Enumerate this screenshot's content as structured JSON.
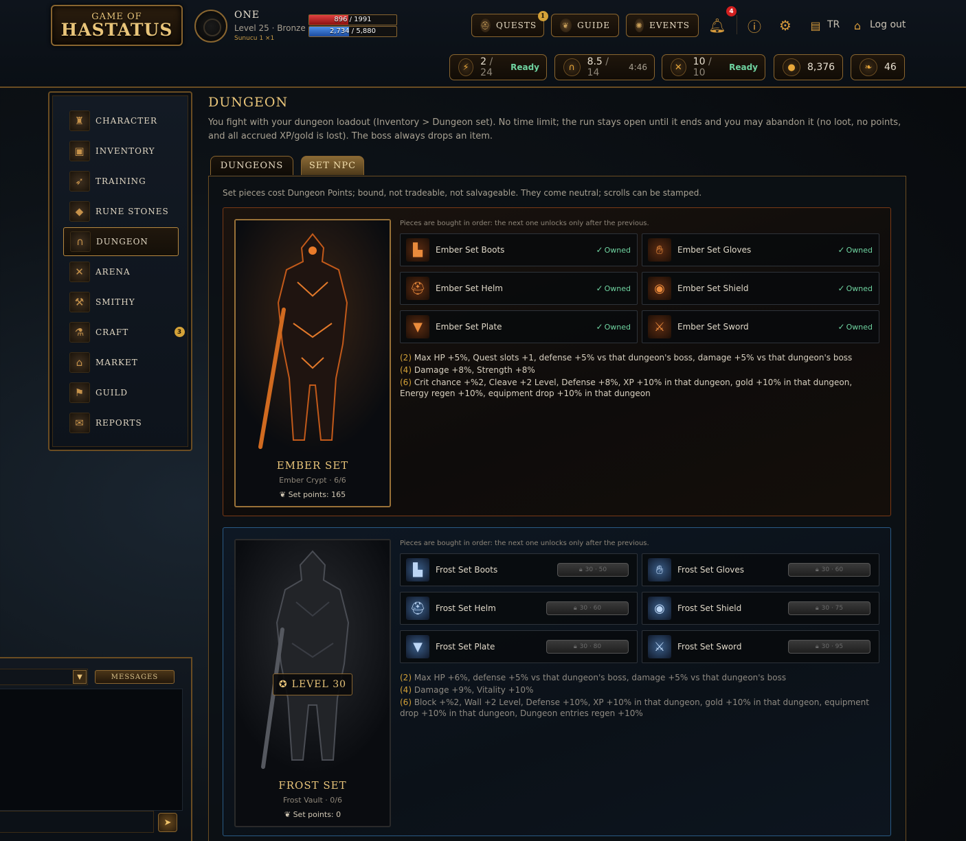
{
  "logo": {
    "line1": "GAME OF",
    "line2": "HASTATUS"
  },
  "player": {
    "name": "ONE",
    "level": "Level 25 · Bronze",
    "guild": "Sunucu 1 ×1",
    "hp": "896 / 1991",
    "hp_frac": 0.45,
    "xp": "2,734 / 5,880",
    "xp_frac": 0.46
  },
  "nav": {
    "quests": "QUESTS",
    "quests_badge": "1",
    "guide": "GUIDE",
    "events": "EVENTS",
    "alerts_badge": "4",
    "lang": "TR",
    "logout": "Log out"
  },
  "resources": {
    "energy": {
      "cur": "2",
      "max": "/ 24",
      "status": "Ready"
    },
    "dungeon": {
      "cur": "8.5",
      "max": "/ 14",
      "time": "4:46"
    },
    "arena": {
      "cur": "10",
      "max": "/ 10",
      "status": "Ready"
    },
    "gold": "8,376",
    "gems": "46"
  },
  "sidebar": {
    "items": [
      {
        "label": "CHARACTER"
      },
      {
        "label": "INVENTORY"
      },
      {
        "label": "TRAINING"
      },
      {
        "label": "RUNE STONES"
      },
      {
        "label": "DUNGEON"
      },
      {
        "label": "ARENA"
      },
      {
        "label": "SMITHY"
      },
      {
        "label": "CRAFT",
        "badge": "3"
      },
      {
        "label": "MARKET"
      },
      {
        "label": "GUILD"
      },
      {
        "label": "REPORTS"
      }
    ]
  },
  "chat": {
    "messages_label": "MESSAGES"
  },
  "page": {
    "title": "DUNGEON",
    "description": "You fight with your dungeon loadout (Inventory > Dungeon set). No time limit; the run stays open until it ends and you may abandon it (no loot, no points, and all accrued XP/gold is lost). The boss always drops an item.",
    "tabs": [
      "DUNGEONS",
      "SET NPC"
    ],
    "note": "Set pieces cost Dungeon Points; bound, not tradeable, not salvageable. They come neutral; scrolls can be stamped."
  },
  "sets": [
    {
      "name": "EMBER SET",
      "sub": "Ember Crypt · 6/6",
      "points": "Set points: 165",
      "order_note": "Pieces are bought in order: the next one unlocks only after the previous.",
      "pieces": [
        {
          "name": "Ember Set Boots",
          "status": "Owned"
        },
        {
          "name": "Ember Set Gloves",
          "status": "Owned"
        },
        {
          "name": "Ember Set Helm",
          "status": "Owned"
        },
        {
          "name": "Ember Set Shield",
          "status": "Owned"
        },
        {
          "name": "Ember Set Plate",
          "status": "Owned"
        },
        {
          "name": "Ember Set Sword",
          "status": "Owned"
        }
      ],
      "bonuses": [
        {
          "n": "(2)",
          "text": "Max HP +5%, Quest slots +1, defense +5% vs that dungeon's boss, damage +5% vs that dungeon's boss"
        },
        {
          "n": "(4)",
          "text": "Damage +8%, Strength +8%"
        },
        {
          "n": "(6)",
          "text": "Crit chance +%2, Cleave +2 Level, Defense +8%, XP +10% in that dungeon, gold +10% in that dungeon, Energy regen +10%, equipment drop +10% in that dungeon"
        }
      ]
    },
    {
      "name": "FROST SET",
      "sub": "Frost Vault · 0/6",
      "points": "Set points: 0",
      "level": "LEVEL 30",
      "order_note": "Pieces are bought in order: the next one unlocks only after the previous.",
      "pieces": [
        {
          "name": "Frost Set Boots",
          "cost": "30 · 50"
        },
        {
          "name": "Frost Set Gloves",
          "cost": "30 · 60"
        },
        {
          "name": "Frost Set Helm",
          "cost": "30 · 60"
        },
        {
          "name": "Frost Set Shield",
          "cost": "30 · 75"
        },
        {
          "name": "Frost Set Plate",
          "cost": "30 · 80"
        },
        {
          "name": "Frost Set Sword",
          "cost": "30 · 95"
        }
      ],
      "bonuses": [
        {
          "n": "(2)",
          "text": "Max HP +6%, defense +5% vs that dungeon's boss, damage +5% vs that dungeon's boss"
        },
        {
          "n": "(4)",
          "text": "Damage +9%, Vitality +10%"
        },
        {
          "n": "(6)",
          "text": "Block +%2, Wall +2 Level, Defense +10%, XP +10% in that dungeon, gold +10% in that dungeon, equipment drop +10% in that dungeon, Dungeon entries regen +10%"
        }
      ]
    }
  ]
}
